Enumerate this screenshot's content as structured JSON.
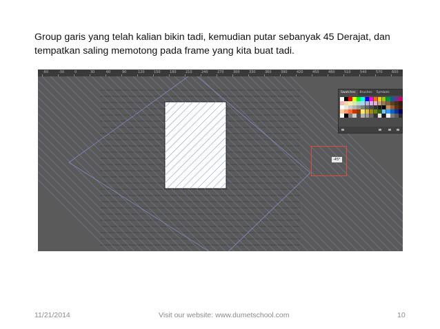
{
  "slide": {
    "text_lines": [
      "Group garis yang telah kalian bikin tadi, kemudian putar sebanyak 45 Derajat, dan",
      "tempatkan saling memotong pada frame yang kita buat tadi."
    ]
  },
  "screenshot": {
    "ruler_labels": [
      "-60",
      "-30",
      "0",
      "30",
      "60",
      "90",
      "120",
      "150",
      "180",
      "210",
      "240",
      "270",
      "300",
      "330",
      "360",
      "390",
      "420",
      "450",
      "480",
      "510",
      "540",
      "570",
      "600"
    ],
    "swatches_panel": {
      "tabs": [
        "Swatches",
        "Brushes",
        "Symbols"
      ],
      "colors": [
        "#ffffff",
        "#000000",
        "#ff0000",
        "#ffff00",
        "#00ff00",
        "#00ffff",
        "#0000ff",
        "#ff00ff",
        "#ff6600",
        "#ffcc00",
        "#99cc00",
        "#009933",
        "#006699",
        "#663399",
        "#cc0066",
        "#f2b9b9",
        "#f7d7a8",
        "#fff2a8",
        "#d4eca8",
        "#a8e0c7",
        "#a8d8ec",
        "#b0b8e8",
        "#d2b0e8",
        "#e8b0cf",
        "#c8a080",
        "#a07850",
        "#806040",
        "#604020",
        "#403020",
        "#302010",
        "#ffffff",
        "#e6e6e6",
        "#cccccc",
        "#b3b3b3",
        "#999999",
        "#808080",
        "#666666",
        "#4d4d4d",
        "#333333",
        "#1a1a1a",
        "#000000",
        "#c09060",
        "#906030",
        "#603010",
        "#402008",
        "#ffcc99",
        "#ff9966",
        "#ff6633",
        "#cc3300",
        "#993300",
        "#ffee66",
        "#ddbb33",
        "#aa8800",
        "#668800",
        "#336600",
        "#66ccff",
        "#3399ff",
        "#0066cc",
        "#003399",
        "#000066",
        "#ffffff",
        "#000000",
        "#808080",
        "#cccccc",
        "#4d4d4d",
        "#b3b3b3",
        "#999999",
        "#666666",
        "#333333",
        "#e6e6e6",
        "#1a1a1a",
        "#f0f0f0",
        "#7a7a7a",
        "#5a5a5a",
        "#2a2a2a"
      ]
    },
    "rotation_tooltip": "-45°"
  },
  "footer": {
    "date": "11/21/2014",
    "website": "Visit our website: www.dumetschool.com",
    "page_number": "10"
  }
}
